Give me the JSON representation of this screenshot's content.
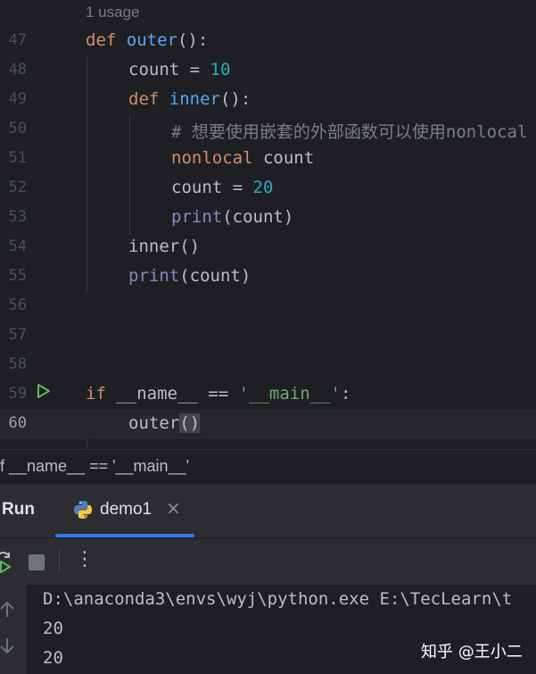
{
  "editor": {
    "usage_hint": "1 usage",
    "lines": [
      {
        "num": "47"
      },
      {
        "num": "48"
      },
      {
        "num": "49"
      },
      {
        "num": "50"
      },
      {
        "num": "51"
      },
      {
        "num": "52"
      },
      {
        "num": "53"
      },
      {
        "num": "54"
      },
      {
        "num": "55"
      },
      {
        "num": "56"
      },
      {
        "num": "57"
      },
      {
        "num": "58"
      },
      {
        "num": "59"
      },
      {
        "num": "60"
      }
    ],
    "tokens": {
      "def": "def",
      "outer": "outer",
      "outer_sig": "():",
      "count": "count",
      "eq": " = ",
      "ten": "10",
      "inner": "inner",
      "inner_sig": "():",
      "comment": "# 想要使用嵌套的外部函数可以使用nonlocal",
      "nonlocal": "nonlocal",
      "count_sp": " count",
      "twenty": "20",
      "print": "print",
      "print_arg": "(count)",
      "inner_call": "inner()",
      "if": "if",
      "name_cmp": " __name__ == ",
      "main_str": "'__main__'",
      "colon": ":",
      "outer_call_name": "outer",
      "open_paren": "(",
      "close_paren": ")"
    }
  },
  "breadcrumb": {
    "text": "if __name__ == '__main__'"
  },
  "tool_window": {
    "title": "Run",
    "tab_label": "demo1",
    "tab_close": "×",
    "more": "⋮"
  },
  "console": {
    "lines": [
      "D:\\anaconda3\\envs\\wyj\\python.exe E:\\TecLearn\\t",
      "20",
      "20"
    ]
  },
  "watermark": {
    "text": "知乎 @王小二"
  },
  "colors": {
    "background": "#1e1f22",
    "keyword": "#cf8e6d",
    "function": "#56a8f5",
    "number": "#2aacb8",
    "string": "#6aab73",
    "accent": "#3574f0",
    "run_gutter": "#5fb865"
  }
}
